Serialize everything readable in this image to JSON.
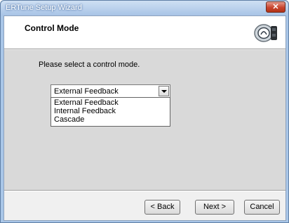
{
  "window": {
    "title": "ERTune Setup Wizard",
    "close_label": "✕"
  },
  "header": {
    "title": "Control Mode",
    "icon": "camera-gauge-icon"
  },
  "main": {
    "prompt": "Please select a control mode.",
    "control_mode": {
      "selected": "External Feedback",
      "options": [
        "External Feedback",
        "Internal Feedback",
        "Cascade"
      ]
    }
  },
  "footer": {
    "back_label": "< Back",
    "next_label": "Next >",
    "cancel_label": "Cancel"
  }
}
